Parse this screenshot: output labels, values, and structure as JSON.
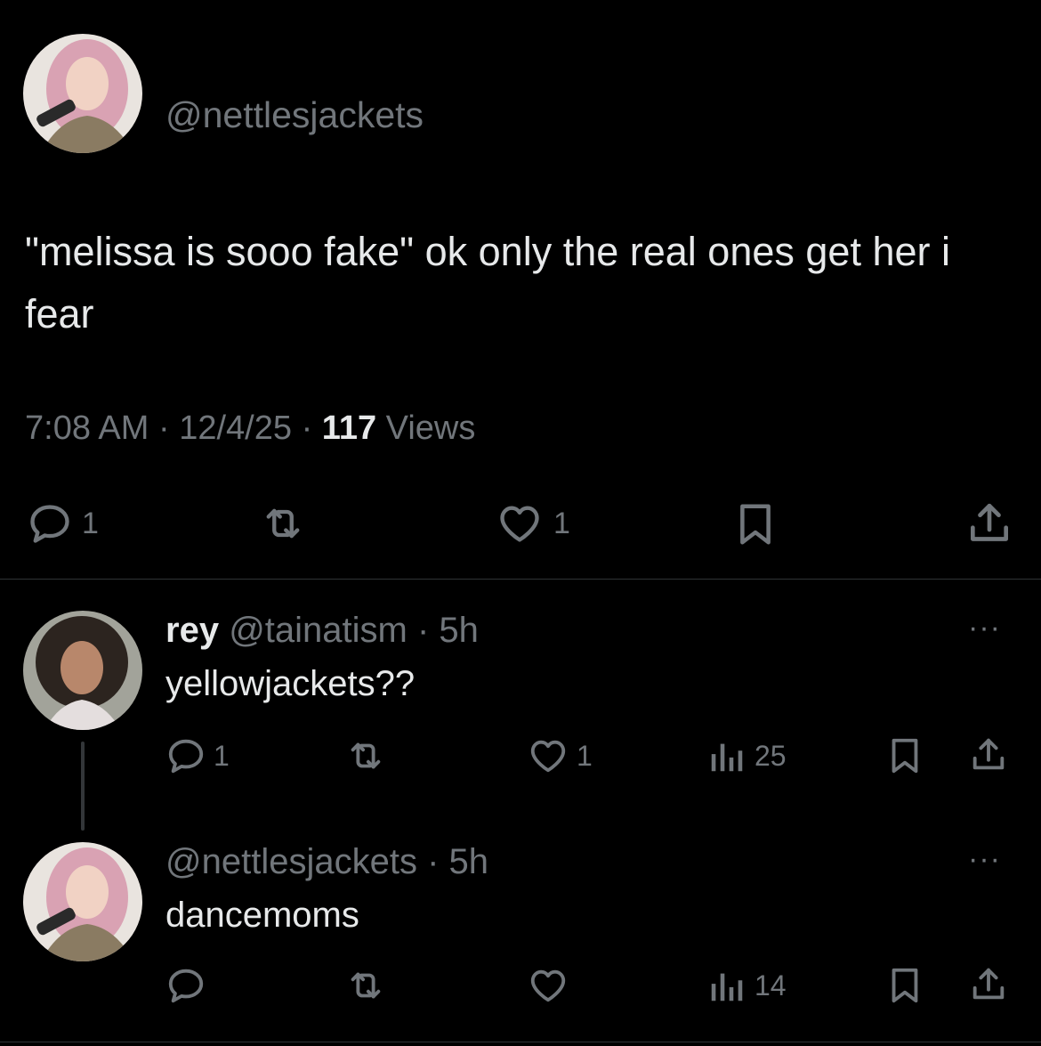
{
  "main_tweet": {
    "handle": "@nettlesjackets",
    "text": "\"melissa is sooo fake\" ok only the real ones get her i fear",
    "time": "7:08 AM",
    "date": "12/4/25",
    "views_count": "117",
    "views_label": "Views",
    "separator": "·",
    "actions": {
      "reply_count": "1",
      "like_count": "1"
    }
  },
  "replies": [
    {
      "name": "rey",
      "handle": "@tainatism",
      "time": "· 5h",
      "text": "yellowjackets??",
      "reply_count": "1",
      "like_count": "1",
      "views": "25",
      "more": "···"
    },
    {
      "handle": "@nettlesjackets",
      "time": "· 5h",
      "text": "dancemoms",
      "views": "14",
      "more": "···"
    }
  ],
  "icons": {
    "reply": "reply-icon",
    "repost": "repost-icon",
    "like": "heart-icon",
    "bookmark": "bookmark-icon",
    "share": "share-icon",
    "views": "views-icon"
  },
  "colors": {
    "background": "#000000",
    "text": "#e7e9ea",
    "muted": "#71767b",
    "divider": "#2f3336"
  }
}
